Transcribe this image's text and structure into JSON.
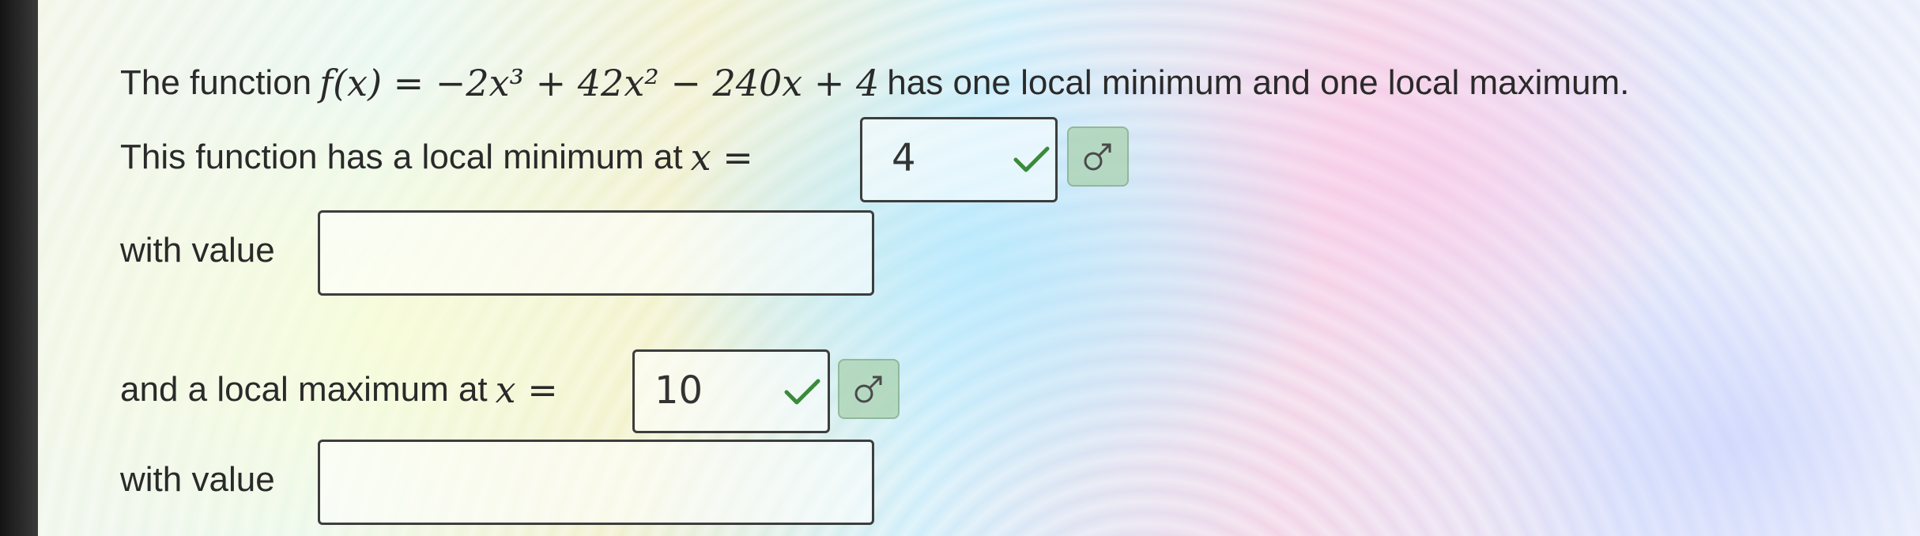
{
  "problem": {
    "intro": "The function",
    "function_expression": "f(x) = −2x³ + 42x² − 240x + 4",
    "outro": "has one local minimum and one local maximum."
  },
  "minimum": {
    "label": "This function has a local minimum at",
    "var": "x =",
    "x_value": "4",
    "value_label": "with value",
    "value_input": ""
  },
  "maximum": {
    "label": "and a local maximum at",
    "var": "x =",
    "x_value": "10",
    "value_label": "with value",
    "value_input": ""
  },
  "icons": {
    "check": "checkmark-icon",
    "hint": "gender-symbol-icon"
  },
  "colors": {
    "check": "#3a8a3a",
    "hint_button": "#aad2af"
  }
}
